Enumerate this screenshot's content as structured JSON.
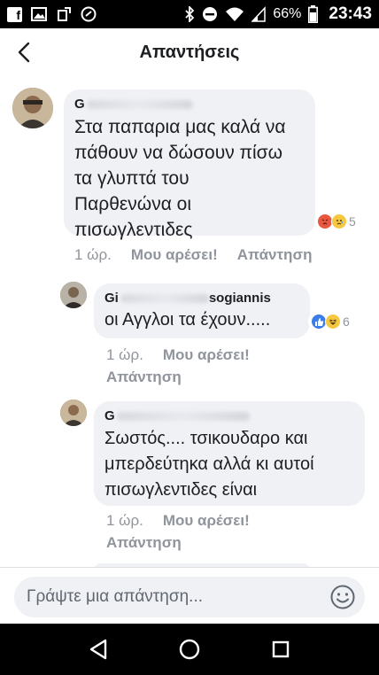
{
  "status_bar": {
    "battery_percent": "66%",
    "time": "23:43",
    "icons": [
      "facebook-icon",
      "image-icon",
      "rotate-icon",
      "shield-icon",
      "bluetooth-icon",
      "do-not-disturb-icon",
      "wifi-icon",
      "signal-icon",
      "battery-icon"
    ]
  },
  "header": {
    "title": "Απαντήσεις",
    "back_icon": "back-arrow-icon"
  },
  "comments": [
    {
      "author": "G",
      "text_lines": [
        "Στα παπαρια μας καλά να",
        "πάθουν να δώσουν πίσω",
        "τα γλυπτά του",
        "Παρθενώνα οι",
        "πισωγλεντιδες"
      ],
      "reactions": [
        "angry",
        "sad"
      ],
      "reaction_count": "5",
      "time": "1 ώρ.",
      "like_label": "Μου αρέσει!",
      "reply_label": "Απάντηση"
    },
    {
      "author": "Gi",
      "author_suffix": "sogiannis",
      "text_lines": [
        "οι Αγγλοι τα έχουν....."
      ],
      "reactions": [
        "like",
        "haha"
      ],
      "reaction_count": "6",
      "time": "1 ώρ.",
      "like_label": "Μου αρέσει!",
      "reply_label": "Απάντηση"
    },
    {
      "author": "G",
      "text_lines": [
        "Σωστός.... τσικουδαρο και",
        "μπερδεύτηκα αλλά κι αυτοί",
        "πισωγλεντιδες είναι"
      ],
      "time": "1 ώρ.",
      "like_label": "Μου αρέσει!",
      "reply_label": "Απάντηση"
    }
  ],
  "composer": {
    "placeholder": "Γράψτε μια απάντηση...",
    "emoji_icon": "smiley-icon"
  },
  "nav_bar": {
    "icons": [
      "back-triangle-icon",
      "home-icon",
      "recents-icon"
    ]
  },
  "colors": {
    "bubble": "#f0f1f5",
    "meta_text": "#90949c",
    "primary_text": "#1c1e21",
    "status_bar": "#000000"
  }
}
